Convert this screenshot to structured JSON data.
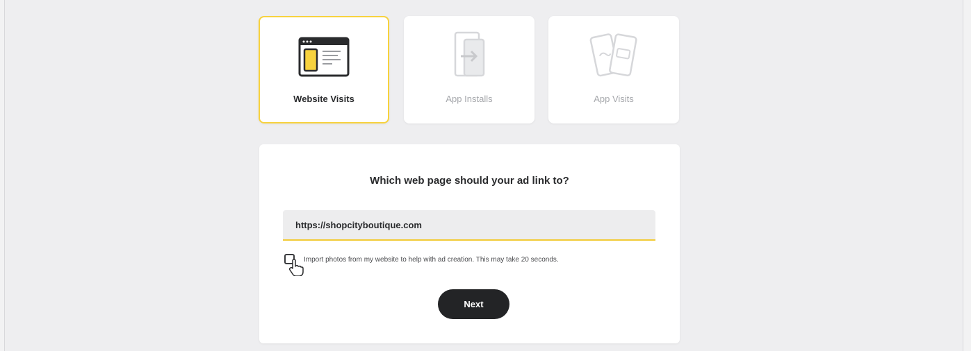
{
  "goals": [
    {
      "label": "Website Visits",
      "icon": "browser-window-icon",
      "selected": true
    },
    {
      "label": "App Installs",
      "icon": "phone-download-icon",
      "selected": false
    },
    {
      "label": "App Visits",
      "icon": "two-phones-icon",
      "selected": false
    }
  ],
  "link_form": {
    "question": "Which web page should your ad link to?",
    "url_value": "https://shopcityboutique.com",
    "import_label": "Import photos from my website to help with ad creation. This may take 20 seconds.",
    "import_checked": false,
    "next_label": "Next"
  },
  "colors": {
    "accent_yellow": "#f7d23e",
    "button_dark": "#232426",
    "background": "#eeeef0"
  }
}
